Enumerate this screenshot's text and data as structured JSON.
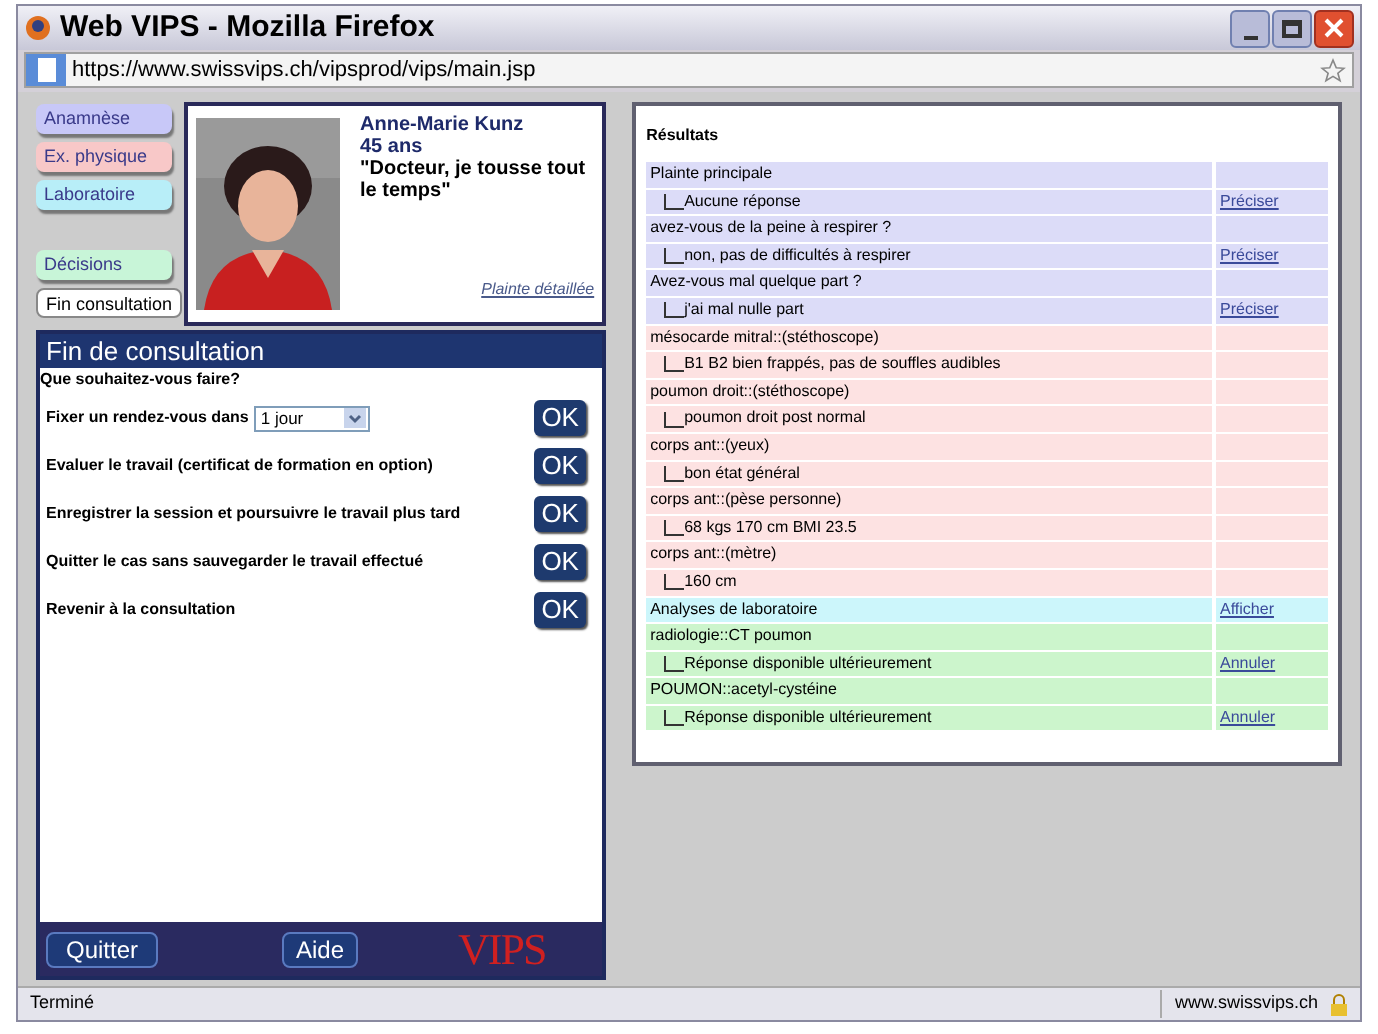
{
  "window": {
    "title": "Web VIPS - Mozilla Firefox"
  },
  "address_bar": {
    "url": "https://www.swissvips.ch/vipsprod/vips/main.jsp"
  },
  "nav_tabs": [
    {
      "label": "Anamnèse",
      "color": "#c8c8f8",
      "selected": false
    },
    {
      "label": "Ex. physique",
      "color": "#f8c8c8",
      "selected": false
    },
    {
      "label": "Laboratoire",
      "color": "#b8eef8",
      "selected": false
    },
    {
      "label": "Décisions",
      "color": "#c8f5d8",
      "selected": false
    },
    {
      "label": "Fin consultation",
      "color": "#ffffff",
      "selected": true
    }
  ],
  "patient": {
    "name": "Anne-Marie Kunz",
    "age": "45 ans",
    "complaint": "\"Docteur, je tousse tout le temps\"",
    "link": "Plainte détaillée"
  },
  "panel": {
    "title": "Fin de consultation",
    "question": "Que souhaitez-vous faire?",
    "options": [
      {
        "kind": "select",
        "label": "Fixer un rendez-vous dans",
        "value": "1 jour",
        "button": "OK"
      },
      {
        "kind": "plain",
        "label": "Evaluer le travail (certificat de formation en option)",
        "button": "OK"
      },
      {
        "kind": "plain",
        "label": "Enregistrer la session et poursuivre le travail plus tard",
        "button": "OK"
      },
      {
        "kind": "plain",
        "label": "Quitter le cas sans sauvegarder le travail effectué",
        "button": "OK"
      },
      {
        "kind": "plain",
        "label": "Revenir à la consultation",
        "button": "OK"
      }
    ]
  },
  "footer": {
    "buttons": [
      "Quitter",
      "Aide"
    ],
    "logo": "VIPS"
  },
  "results": {
    "title": "Résultats",
    "sections": [
      {
        "color": "#dcdcf8",
        "rows": [
          {
            "kind": "question",
            "text": "Plainte principale"
          },
          {
            "kind": "answer",
            "text": "Aucune réponse",
            "action": "Préciser"
          },
          {
            "kind": "question",
            "text": "avez-vous de la peine à respirer ?"
          },
          {
            "kind": "answer",
            "text": "non, pas de difficultés à respirer",
            "action": "Préciser"
          },
          {
            "kind": "question",
            "text": "Avez-vous mal quelque part ?"
          },
          {
            "kind": "answer",
            "text": "j'ai mal nulle part",
            "action": "Préciser"
          }
        ]
      },
      {
        "color": "#fde2e2",
        "rows": [
          {
            "kind": "question",
            "text": "mésocarde mitral::(stéthoscope)"
          },
          {
            "kind": "answer",
            "text": "B1 B2 bien frappés, pas de souffles audibles"
          },
          {
            "kind": "question",
            "text": "poumon droit::(stéthoscope)"
          },
          {
            "kind": "answer",
            "text": "poumon droit post normal"
          },
          {
            "kind": "question",
            "text": "corps ant::(yeux)"
          },
          {
            "kind": "answer",
            "text": "bon état général"
          },
          {
            "kind": "question",
            "text": "corps ant::(pèse personne)"
          },
          {
            "kind": "answer",
            "text": "68 kgs 170 cm BMI 23.5"
          },
          {
            "kind": "question",
            "text": "corps ant::(mètre)"
          },
          {
            "kind": "answer",
            "text": "160 cm"
          }
        ]
      },
      {
        "color": "#ccf6fb",
        "rows": [
          {
            "kind": "question",
            "text": "Analyses de laboratoire",
            "action": "Afficher"
          }
        ]
      },
      {
        "color": "#ccf5cc",
        "rows": [
          {
            "kind": "question",
            "text": "radiologie::CT poumon"
          },
          {
            "kind": "answer",
            "text": "Réponse disponible ultérieurement",
            "action": "Annuler"
          },
          {
            "kind": "question",
            "text": "POUMON::acetyl-cystéine"
          },
          {
            "kind": "answer",
            "text": "Réponse disponible ultérieurement",
            "action": "Annuler"
          }
        ]
      }
    ]
  },
  "status_bar": {
    "text": "Terminé",
    "domain": "www.swissvips.ch"
  }
}
